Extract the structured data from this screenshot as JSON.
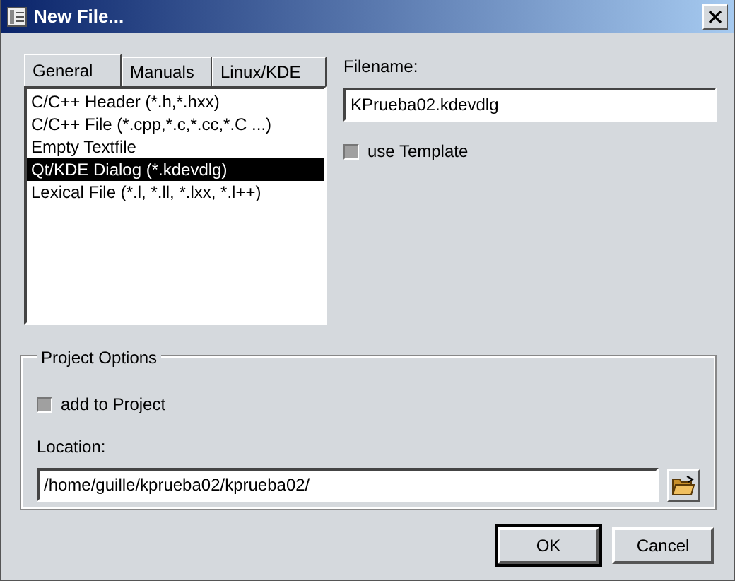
{
  "window": {
    "title": "New File..."
  },
  "tabs": [
    {
      "label": "General",
      "selected": true
    },
    {
      "label": "Manuals",
      "selected": false
    },
    {
      "label": "Linux/KDE",
      "selected": false
    }
  ],
  "file_types": [
    {
      "label": "C/C++ Header (*.h,*.hxx)",
      "selected": false
    },
    {
      "label": "C/C++ File (*.cpp,*.c,*.cc,*.C ...)",
      "selected": false
    },
    {
      "label": "Empty Textfile",
      "selected": false
    },
    {
      "label": "Qt/KDE Dialog (*.kdevdlg)",
      "selected": true
    },
    {
      "label": "Lexical File (*.l, *.ll, *.lxx, *.l++)",
      "selected": false
    }
  ],
  "filename": {
    "label": "Filename:",
    "value": "KPrueba02.kdevdlg"
  },
  "use_template": {
    "label": "use Template",
    "checked": false,
    "disabled": true
  },
  "project_options": {
    "title": "Project Options",
    "add_to_project": {
      "label": "add to Project",
      "checked": false,
      "disabled": true
    },
    "location": {
      "label": "Location:",
      "value": "/home/guille/kprueba02/kprueba02/"
    }
  },
  "buttons": [
    {
      "label": "OK",
      "default": true
    },
    {
      "label": "Cancel",
      "default": false
    }
  ]
}
